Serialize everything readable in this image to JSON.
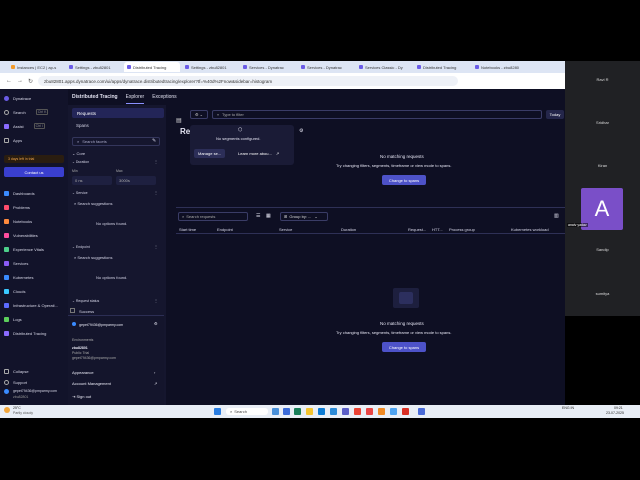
{
  "browser": {
    "tabs": [
      {
        "label": "Instances | EC2 | ap-s",
        "color": "#f29b2b"
      },
      {
        "label": "Settings - zbu82801",
        "color": "#6b5ce7"
      },
      {
        "label": "Distributed Tracing",
        "color": "#6b5ce7",
        "active": true
      },
      {
        "label": "Settings - zbu82801",
        "color": "#6b5ce7"
      },
      {
        "label": "Services - Dynatrac",
        "color": "#6b5ce7"
      },
      {
        "label": "Services - Dynatrac",
        "color": "#6b5ce7"
      },
      {
        "label": "Services Classic - Dy",
        "color": "#6b5ce7"
      },
      {
        "label": "Distributed Tracing",
        "color": "#6b5ce7"
      },
      {
        "label": "Notebooks - zbu8280",
        "color": "#6b5ce7"
      }
    ],
    "url": "zbu82801.apps.dynatrace.com/ui/apps/dynatrace.distributedtracing/explorer?tf=%40d%2Fnow&sidebar=histogram"
  },
  "app": {
    "brand": "Dynatrace",
    "nav": {
      "search": "Search",
      "search_kbd": "Ctrl K",
      "assist": "Assist",
      "assist_kbd": "Ctrl I",
      "apps": "Apps",
      "trial": "3 days left in trial",
      "contact": "Contact us",
      "items": [
        "Dashboards",
        "Problems",
        "Notebooks",
        "Vulnerabilities",
        "Experience Vitals",
        "Services",
        "Kubernetes",
        "Clouds",
        "Infrastructure & Operati...",
        "Logs",
        "Distributed Tracing"
      ],
      "item_colors": [
        "#3a8bff",
        "#ff4d6d",
        "#ff8a3d",
        "#ff4d9e",
        "#4dd08b",
        "#8b5cf6",
        "#3a8bff",
        "#3ac9ff",
        "#5c6bff",
        "#5ccf5c",
        "#8b6bff"
      ],
      "collapse": "Collapse",
      "support": "Support",
      "user_email": "gepet79436@pmparmy.com",
      "user_env": "zbu82801"
    },
    "header": {
      "title": "Distributed Tracing",
      "tabs": [
        "Explorer",
        "Exceptions"
      ]
    },
    "facets": {
      "requests": "Requests",
      "spans": "Spans",
      "search_placeholder": "Search facets",
      "core": "Core",
      "duration": "Duration",
      "min": "Min",
      "max": "Max",
      "min_value": "0 ns",
      "max_value": "3000s",
      "service": "Service",
      "search_suggestions": "Search suggestions",
      "no_options": "No options found.",
      "endpoint": "Endpoint",
      "request_status": "Request status",
      "success": "Success"
    },
    "account": {
      "email": "gepet79436@pmparmy.com",
      "environments_label": "Environments",
      "env_name": "zbu82801",
      "env_type": "Public Trial",
      "env_email": "gepet79436@pmparmy.com",
      "appearance": "Appearance",
      "account_management": "Account Management",
      "sign_out": "Sign out"
    },
    "toolbar": {
      "filter_placeholder": "Type to filter",
      "timeframe": "Today"
    },
    "segments": {
      "message": "No segments configured.",
      "manage": "Manage se...",
      "learn": "Learn more abou..."
    },
    "main": {
      "title_partial": "Re",
      "no_match_title": "No matching requests",
      "no_match_hint": "Try changing filters, segments, timeframe or view mode to spans.",
      "change_button": "Change to spans",
      "search_requests": "Search requests",
      "group_by": "Group by: ...",
      "columns": [
        "Start time",
        "Endpoint",
        "Service",
        "Duration",
        "Request...",
        "HTT...",
        "Process group",
        "Kubernetes workload"
      ]
    }
  },
  "meeting": {
    "participants": [
      "Ravi R",
      "Sridhar",
      "Kiran",
      "Sandip",
      "sumitya"
    ],
    "active_initial": "A",
    "active_name": "anaiv yadav"
  },
  "taskbar": {
    "weather_temp": "25°C",
    "weather_desc": "Partly cloudy",
    "search": "Search",
    "lang": "ENG\nIN",
    "time": "09:21",
    "date": "23-07-2025"
  }
}
